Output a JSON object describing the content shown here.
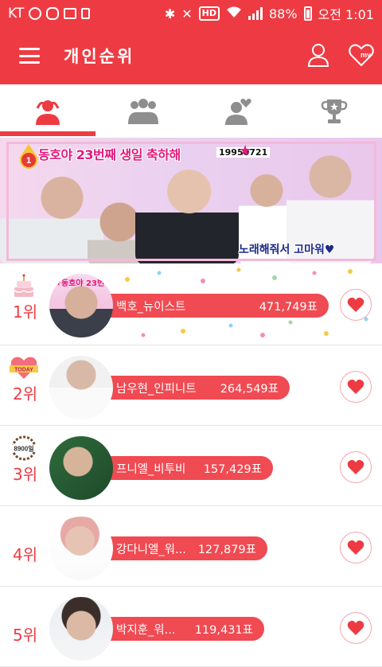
{
  "status_bar": {
    "carrier": "KT",
    "battery": "88%",
    "time": "오전 1:01",
    "hd": "HD"
  },
  "app_bar": {
    "title": "개인순위",
    "my_label": "my"
  },
  "tabs": [
    {
      "name": "individual",
      "icon": "single-person-icon",
      "active": true
    },
    {
      "name": "group",
      "icon": "group-icon",
      "active": false
    },
    {
      "name": "favorite",
      "icon": "person-heart-icon",
      "active": false
    },
    {
      "name": "trophy",
      "icon": "trophy-icon",
      "active": false
    }
  ],
  "banner": {
    "rank_number": "1",
    "headline": "동호야 23번째 생일 축하해",
    "date": "19950721",
    "thanks": "노래해줘서 고마워♥"
  },
  "ranking": [
    {
      "rank": "1위",
      "badge": "cake-icon",
      "name": "백호_뉴이스트",
      "votes": "471,749표",
      "avatar_caption": "★동호야 23번"
    },
    {
      "rank": "2위",
      "badge": "today-heart-icon",
      "name": "남우현_인피니트",
      "votes": "264,549표"
    },
    {
      "rank": "3위",
      "badge": "days-wreath-icon",
      "badge_text": "8900일",
      "name": "프니엘_비투비",
      "votes": "157,429표"
    },
    {
      "rank": "4위",
      "badge": "",
      "name": "강다니엘_워...",
      "votes": "127,879표"
    },
    {
      "rank": "5위",
      "badge": "",
      "name": "박지훈_워...",
      "votes": "119,431표"
    }
  ],
  "colors": {
    "accent": "#ee3b43",
    "pill": "#f04a52",
    "tab_inactive": "#8e8e8e"
  }
}
